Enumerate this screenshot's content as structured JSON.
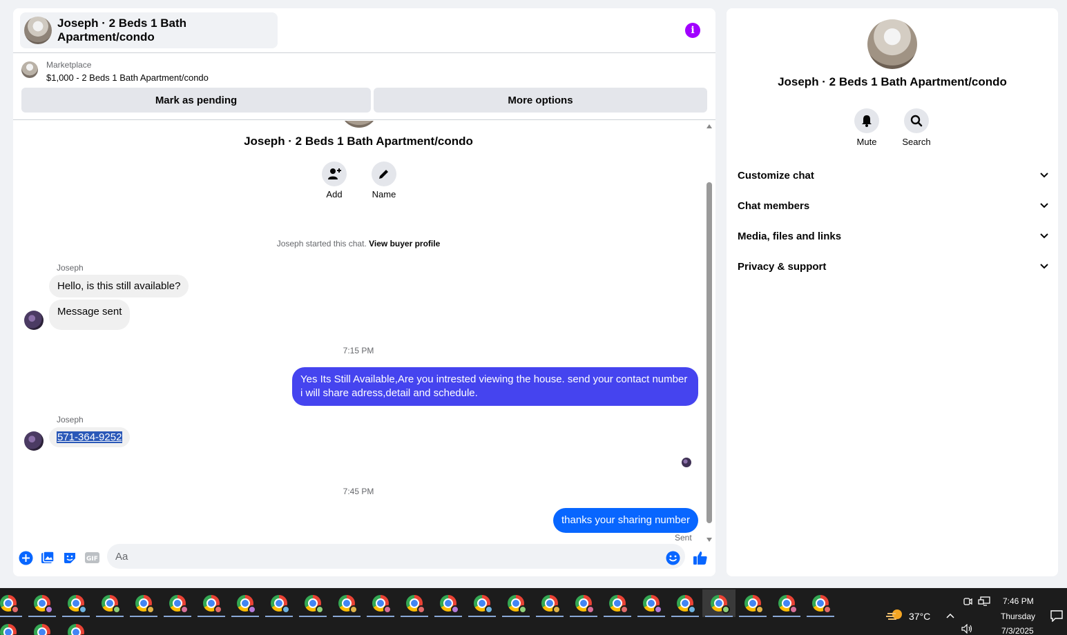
{
  "header": {
    "title": "Joseph · 2 Beds 1 Bath Apartment/condo",
    "info_icon": "info-icon"
  },
  "marketplace": {
    "label": "Marketplace",
    "item": "$1,000 - 2 Beds 1 Bath Apartment/condo",
    "mark_pending": "Mark as pending",
    "more_options": "More options"
  },
  "conversation": {
    "title": "Joseph · 2 Beds 1 Bath Apartment/condo",
    "add_label": "Add",
    "name_label": "Name",
    "started_text": "Joseph started this chat.",
    "view_profile": "View buyer profile",
    "sender_name_1": "Joseph",
    "msg_1": "Hello, is this still available?",
    "msg_2": "Message sent",
    "time_1": "7:15 PM",
    "msg_3": "Yes Its Still Available,Are you intrested viewing the house. send your contact number i will share adress,detail and schedule.",
    "sender_name_2": "Joseph",
    "msg_4": "571-364-9252",
    "time_2": "7:45 PM",
    "msg_5": "thanks your sharing number",
    "sent_status": "Sent"
  },
  "composer": {
    "placeholder": "Aa"
  },
  "info_panel": {
    "name": "Joseph · 2 Beds 1 Bath Apartment/condo",
    "mute_label": "Mute",
    "search_label": "Search",
    "sections": [
      "Customize chat",
      "Chat members",
      "Media, files and links",
      "Privacy & support"
    ]
  },
  "taskbar": {
    "temperature": "37°C",
    "time": "7:46 PM",
    "day": "Thursday",
    "date": "7/3/2025"
  },
  "colors": {
    "accent": "#0866ff",
    "bubble_out": "#4544ef",
    "info": "#a100ff"
  }
}
